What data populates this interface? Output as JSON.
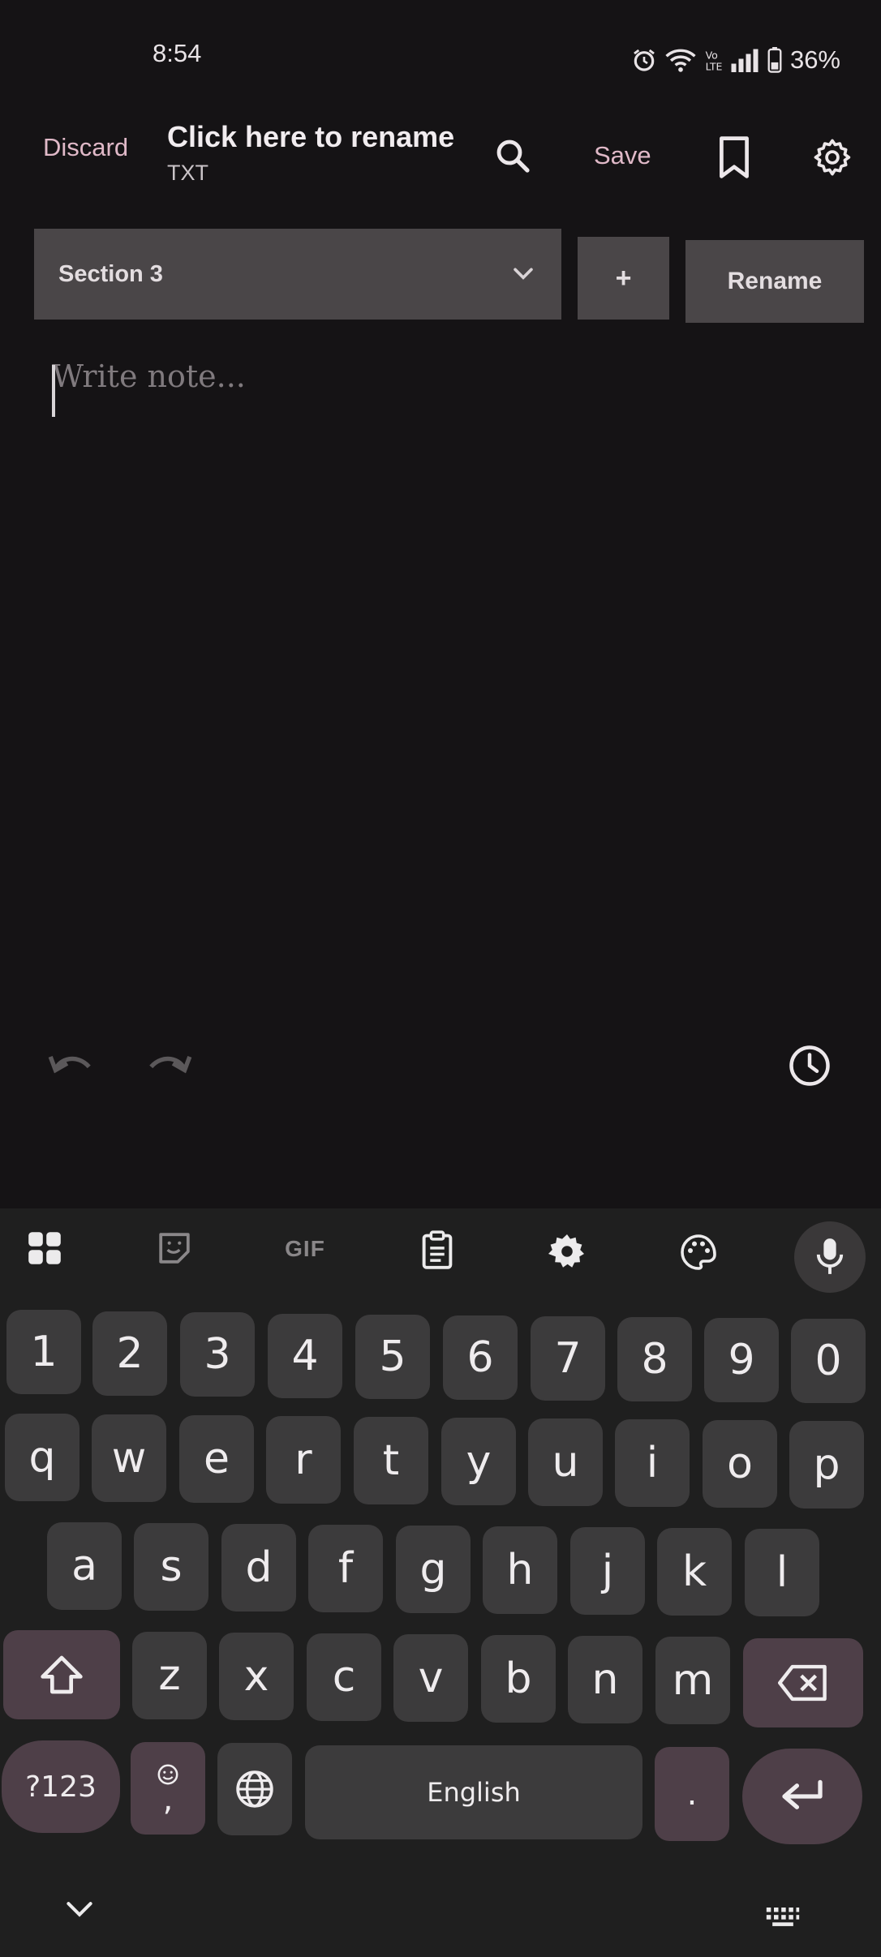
{
  "status_bar": {
    "time": "8:54",
    "battery": "36%",
    "icons": [
      "alarm-icon",
      "wifi-icon",
      "volte-icon",
      "signal-icon",
      "battery-icon"
    ]
  },
  "app_bar": {
    "discard_label": "Discard",
    "title": "Click here to rename",
    "subtitle": "TXT",
    "save_label": "Save",
    "icons": [
      "search-icon",
      "bookmark-icon",
      "settings-icon"
    ]
  },
  "section_bar": {
    "selected_section": "Section 3",
    "add_label": "+",
    "rename_label": "Rename"
  },
  "editor": {
    "placeholder": "Write note...",
    "value": ""
  },
  "editor_toolbar": {
    "icons": [
      "undo-icon",
      "redo-icon",
      "history-icon"
    ]
  },
  "keyboard": {
    "toolbar_icons": [
      "apps-grid-icon",
      "sticker-icon",
      "gif-icon",
      "clipboard-icon",
      "keyboard-settings-icon",
      "palette-icon",
      "mic-icon"
    ],
    "gif_label": "GIF",
    "row_numbers": [
      "1",
      "2",
      "3",
      "4",
      "5",
      "6",
      "7",
      "8",
      "9",
      "0"
    ],
    "row_1": [
      "q",
      "w",
      "e",
      "r",
      "t",
      "y",
      "u",
      "i",
      "o",
      "p"
    ],
    "row_2": [
      "a",
      "s",
      "d",
      "f",
      "g",
      "h",
      "j",
      "k",
      "l"
    ],
    "row_3": [
      "z",
      "x",
      "c",
      "v",
      "b",
      "n",
      "m"
    ],
    "symbols_label": "?123",
    "comma_label": ",",
    "space_label": "English",
    "period_label": "."
  },
  "nav_bar": {
    "icons": [
      "collapse-keyboard-icon",
      "keyboard-switch-icon"
    ]
  },
  "colors": {
    "background": "#151315",
    "accent": "#e0b9c8",
    "keyboard_bg": "#1f1f1f",
    "key": "#3c3b3c",
    "special_key": "#4e3f48"
  }
}
